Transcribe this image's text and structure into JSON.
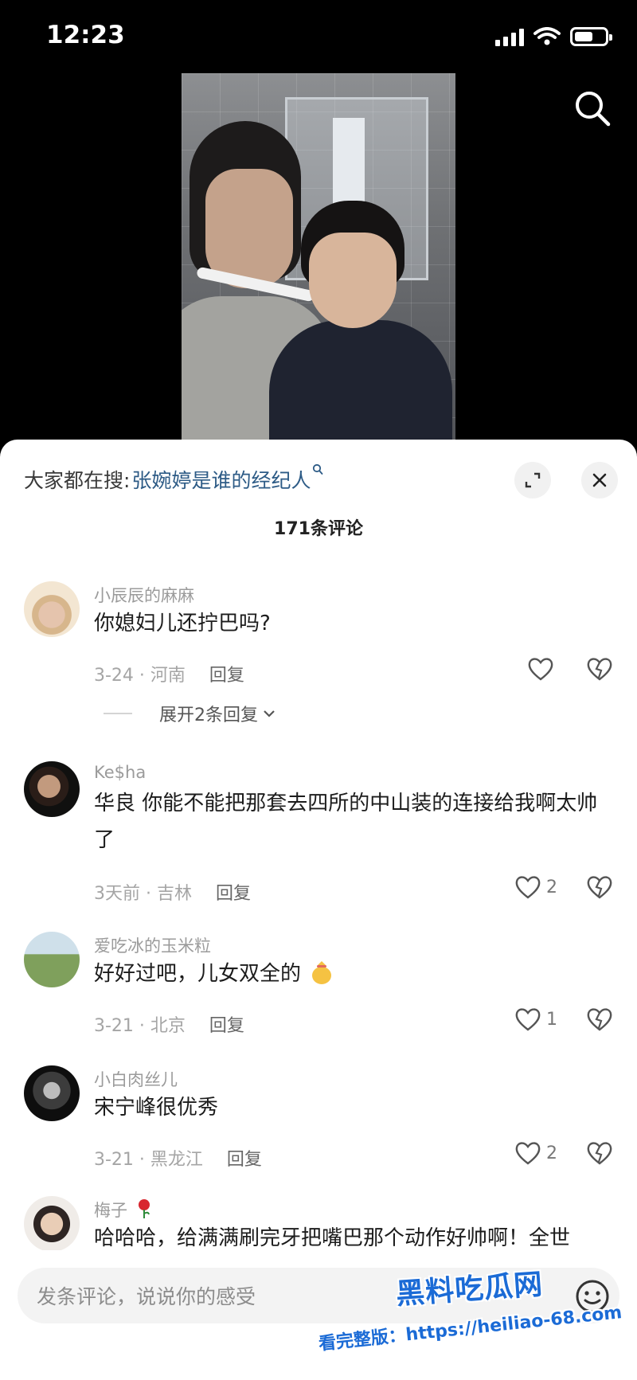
{
  "status_bar": {
    "time": "12:23",
    "signal_bars": 4,
    "battery_level": 0.6
  },
  "hot_search": {
    "prefix": "大家都在搜:",
    "query": "张婉婷是谁的经纪人",
    "query_icon": "search-icon"
  },
  "comment_count": "171条评论",
  "comments": [
    {
      "user": "小辰辰的麻麻",
      "text": "你媳妇儿还拧巴吗?",
      "meta": "3-24 · 河南",
      "reply": "回复",
      "likes": "",
      "expand": "展开2条回复"
    },
    {
      "user": "Ke$ha",
      "text": "华良 你能不能把那套去四所的中山装的连接给我啊太帅了",
      "meta": "3天前 · 吉林",
      "reply": "回复",
      "likes": "2"
    },
    {
      "user": "爱吃冰的玉米粒",
      "text": "好好过吧，儿女双全的",
      "meta": "3-21 · 北京",
      "reply": "回复",
      "likes": "1"
    },
    {
      "user": "小白肉丝儿",
      "text": "宋宁峰很优秀",
      "meta": "3-21 · 黑龙江",
      "reply": "回复",
      "likes": "2"
    },
    {
      "user": "梅子",
      "text": "哈哈哈，给满满刷完牙把嘴巴那个动作好帅啊！全世",
      "meta": "",
      "reply": "",
      "likes": ""
    }
  ],
  "input": {
    "placeholder": "发条评论，说说你的感受"
  },
  "watermark": {
    "title": "黑料吃瓜网",
    "url": "看完整版：https://heiliao-68.com"
  },
  "colors": {
    "link": "#2d5b86",
    "watermark": "#1b6bd6",
    "sheet_bg": "#ffffff"
  }
}
